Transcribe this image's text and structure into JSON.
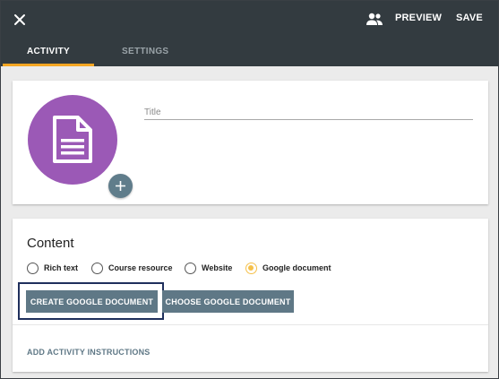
{
  "header": {
    "close_icon": "close-icon",
    "people_icon": "people-icon",
    "preview_label": "PREVIEW",
    "save_label": "SAVE",
    "background": "#333b40"
  },
  "tabs": [
    {
      "label": "ACTIVITY",
      "active": true
    },
    {
      "label": "SETTINGS",
      "active": false
    }
  ],
  "accent_color": "#f5a623",
  "activity": {
    "icon": "document-icon",
    "icon_color": "#9b59b6",
    "add_button_icon": "plus-icon",
    "title": {
      "value": "",
      "placeholder": "Title"
    }
  },
  "content": {
    "heading": "Content",
    "options": [
      {
        "label": "Rich text",
        "selected": false
      },
      {
        "label": "Course resource",
        "selected": false
      },
      {
        "label": "Website",
        "selected": false
      },
      {
        "label": "Google document",
        "selected": true
      }
    ],
    "create_label": "CREATE GOOGLE DOCUMENT",
    "choose_label": "CHOOSE GOOGLE DOCUMENT",
    "instructions_label": "ADD ACTIVITY INSTRUCTIONS",
    "button_color": "#5f7886"
  }
}
